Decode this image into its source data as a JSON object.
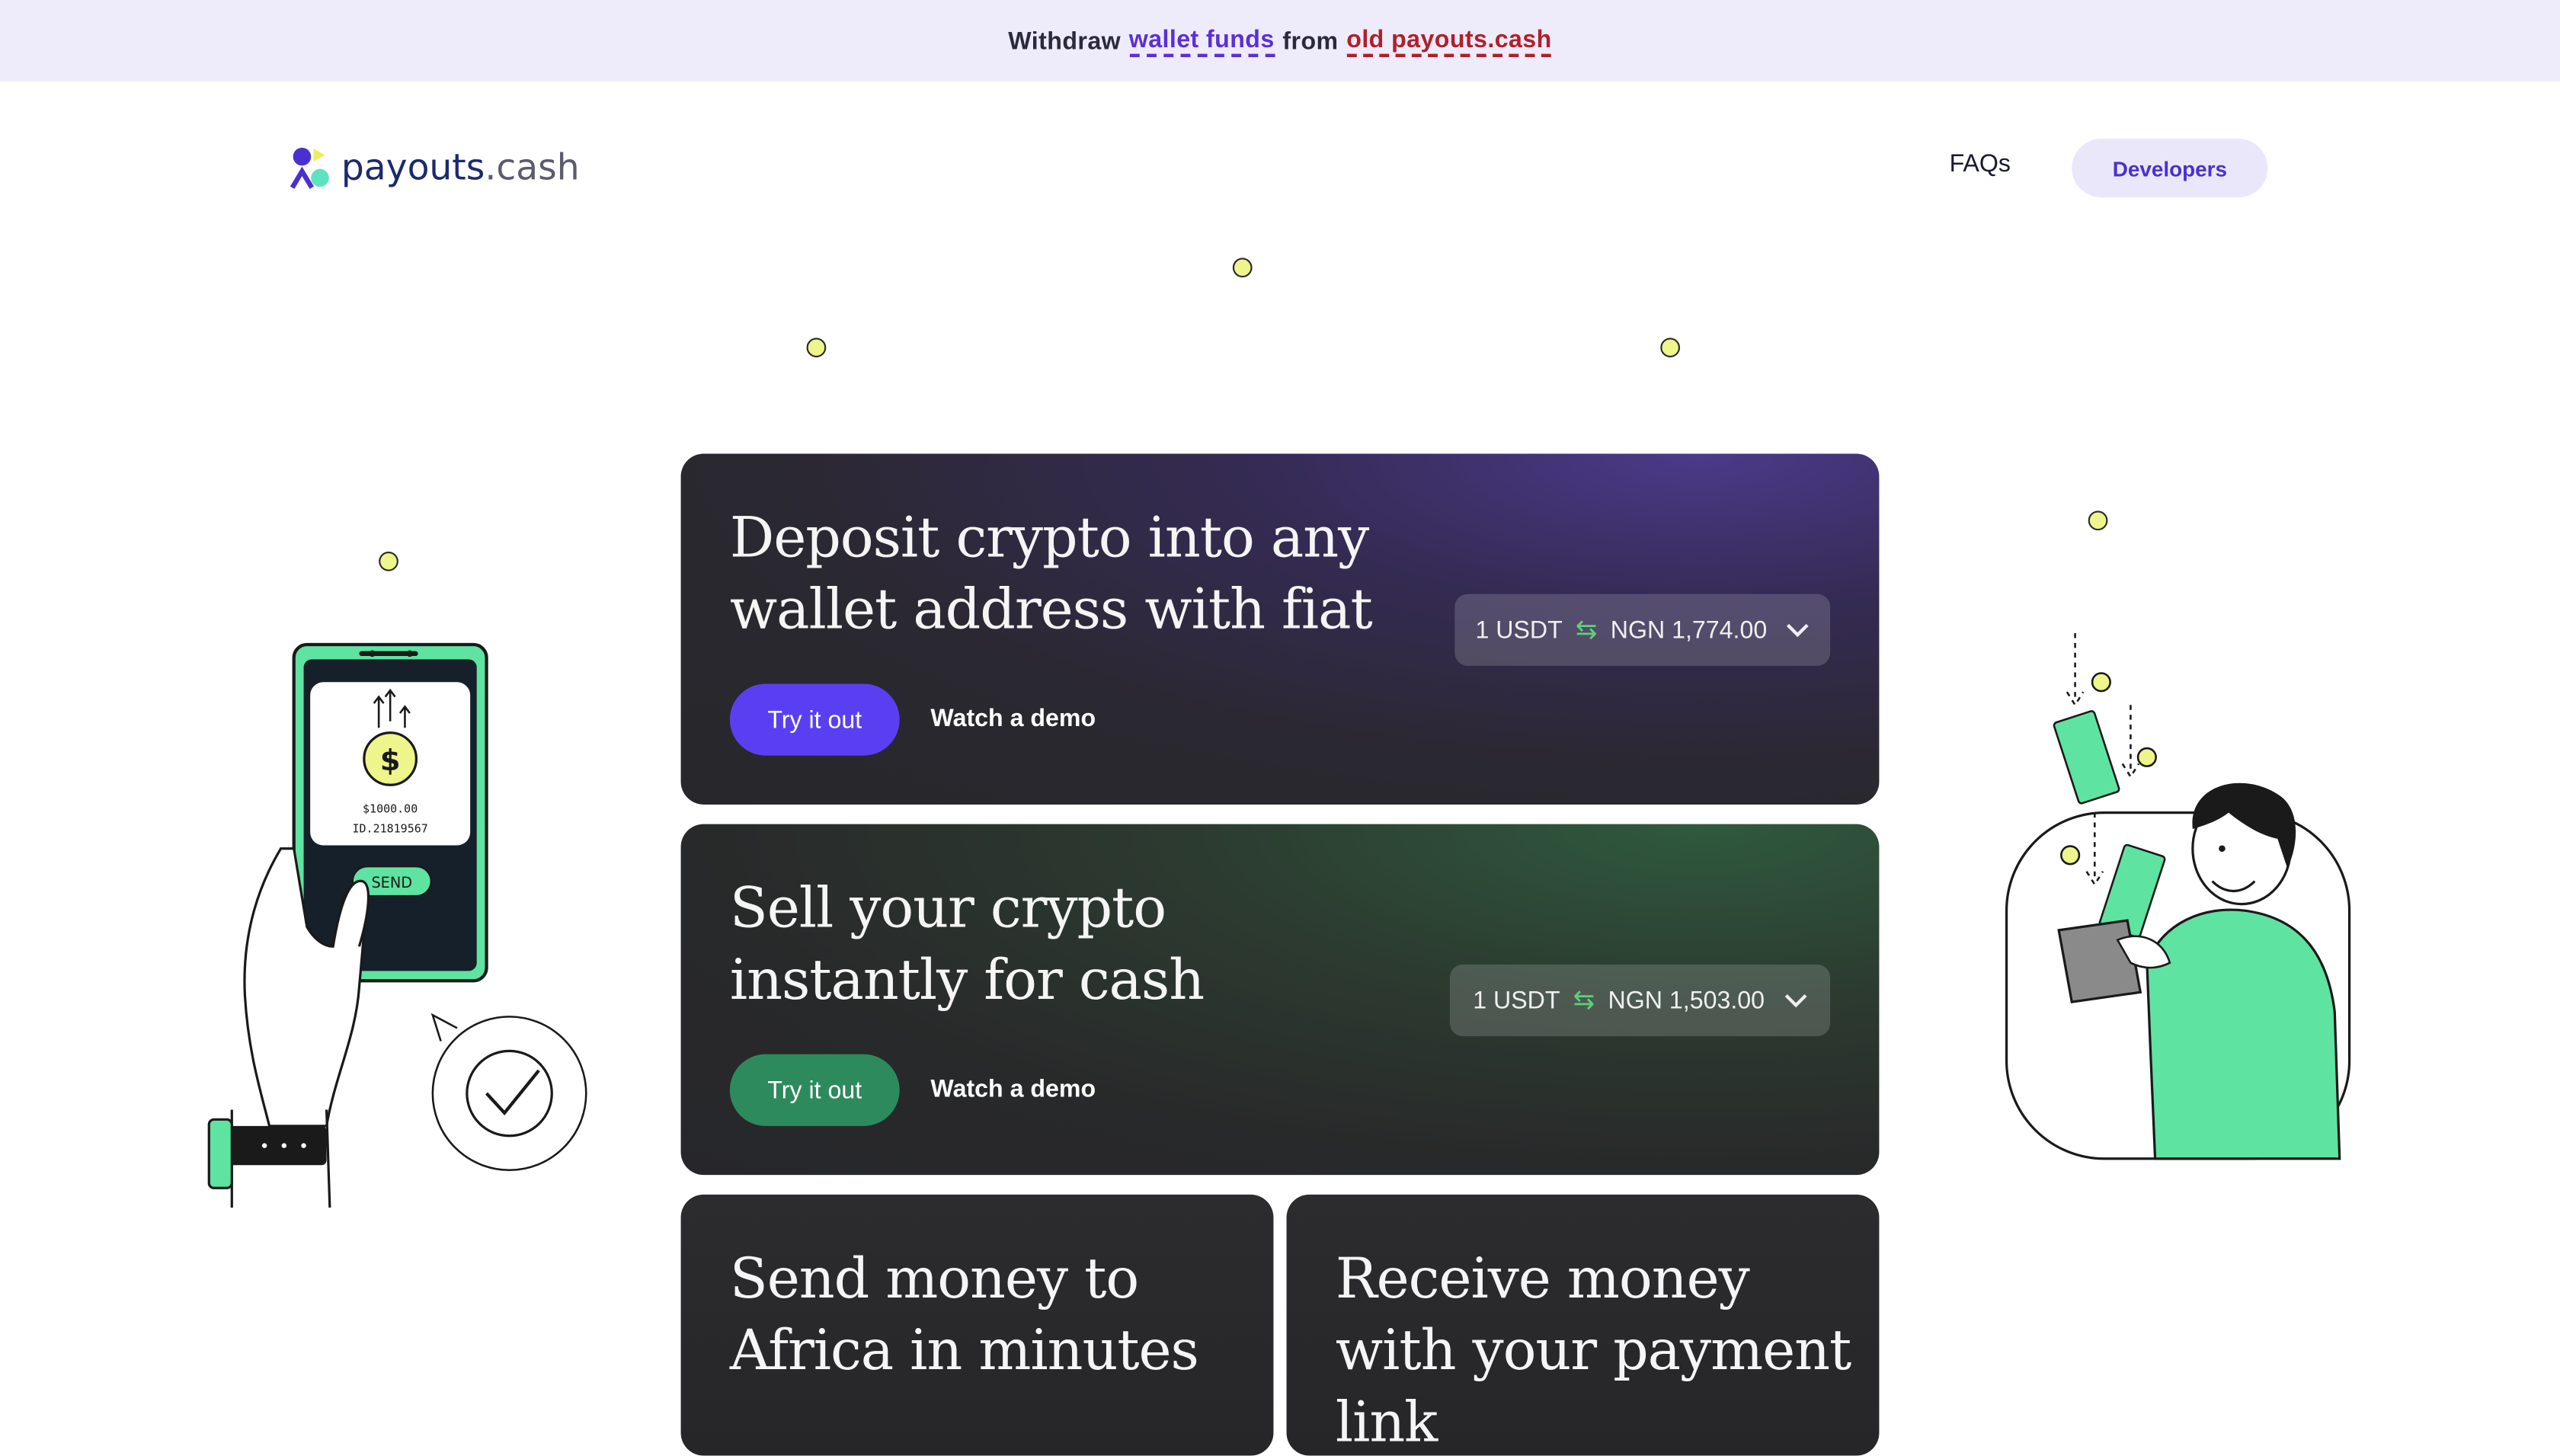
{
  "banner": {
    "prefix": "Withdraw",
    "link1": "wallet funds",
    "middle": "from",
    "link2": "old payouts.cash"
  },
  "header": {
    "logo_part1": "payouts",
    "logo_part2": ".cash",
    "nav": {
      "faqs": "FAQs",
      "developers": "Developers"
    }
  },
  "cards": [
    {
      "title": "Deposit crypto into any wallet address with fiat",
      "try_label": "Try it out",
      "demo_label": "Watch a demo",
      "rate_from": "1 USDT",
      "rate_to": "NGN 1,774.00"
    },
    {
      "title": "Sell your crypto instantly for cash",
      "try_label": "Try it out",
      "demo_label": "Watch a demo",
      "rate_from": "1 USDT",
      "rate_to": "NGN 1,503.00"
    },
    {
      "title": "Send money to Africa in minutes"
    },
    {
      "title": "Receive money with your payment link"
    }
  ],
  "phone_illustration": {
    "amount": "$1000.00",
    "id": "ID.21819567",
    "send": "SEND"
  },
  "colors": {
    "accent_purple": "#5a3ff2",
    "accent_green": "#2d8a5c",
    "banner_bg": "#eeebfb",
    "dot_yellow": "#eef58a",
    "illustration_green": "#5ee3a1"
  }
}
